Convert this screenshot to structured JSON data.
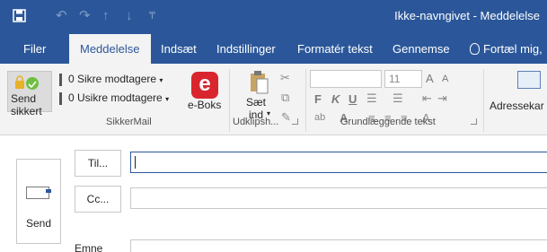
{
  "titlebar": {
    "title": "Ikke-navngivet - Meddelelse",
    "icons": [
      "save-icon",
      "undo-icon",
      "redo-icon",
      "up-arrow-icon",
      "down-arrow-icon",
      "customize-qat-icon"
    ]
  },
  "tabs": [
    {
      "label": "Filer",
      "active": false
    },
    {
      "label": "Meddelelse",
      "active": true
    },
    {
      "label": "Indsæt",
      "active": false
    },
    {
      "label": "Indstillinger",
      "active": false
    },
    {
      "label": "Formatér tekst",
      "active": false
    },
    {
      "label": "Gennemse",
      "active": false
    }
  ],
  "tell_me": "Fortæl mig,",
  "ribbon": {
    "secure_mail": {
      "send_secure_label": "Send\nsikkert",
      "secure_recipients": "0 Sikre modtagere",
      "insecure_recipients": "0 Usikre modtagere",
      "eboks_label": "e-Boks",
      "eboks_letter": "e",
      "group_label": "SikkerMail"
    },
    "clipboard": {
      "paste_label": "Sæt\nind",
      "group_label": "Udklipsh..."
    },
    "basic_text": {
      "font_size": "11",
      "bold": "F",
      "italic": "K",
      "underline": "U",
      "group_label": "Grundlæggende tekst"
    },
    "names": {
      "address_book_label": "Adressekar"
    }
  },
  "compose": {
    "send_label": "Send",
    "to_label": "Til...",
    "cc_label": "Cc...",
    "subject_label": "Emne",
    "to_value": "",
    "cc_value": ""
  },
  "colors": {
    "brand": "#2b579a",
    "eboks": "#d9262e"
  }
}
